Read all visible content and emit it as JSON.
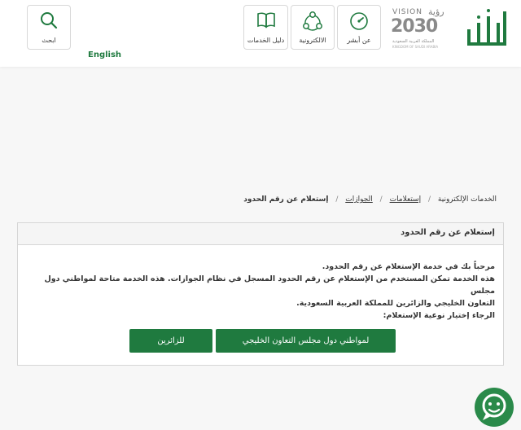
{
  "header": {
    "search_label": "ابحث",
    "english_label": "English",
    "services_guide_label": "دليل الخدمات",
    "electronic_label": "الالكترونية",
    "about_label": "عن أبشر",
    "vision": {
      "line1": "VISION",
      "line1_ar": "رؤية",
      "year": "2030",
      "sub_ar": "المملكة العربية السعودية",
      "sub_en": "KINGDOM OF SAUDI ARABIA"
    },
    "brand_color": "#1f7a3f"
  },
  "breadcrumb": {
    "items": [
      "الخدمات الإلكترونية",
      "إستعلامات",
      "الجوازات"
    ],
    "current": "إستعلام عن رقم الحدود",
    "separator": "/"
  },
  "panel": {
    "title": "إستعلام عن رقم الحدود",
    "lines": [
      "مرحباً بك في خدمة الإستعلام عن رقم الحدود.",
      "هذه الخدمة تمكن المستخدم من الإستعلام عن رقم الحدود المسجل في نظام الجوازات. هذه الخدمة متاحة لمواطني دول مجلس",
      "التعاون الخليجي والزائرين للمملكة العربية السعودية.",
      "الرجاء إختيار نوعية الإستعلام:"
    ],
    "buttons": {
      "gcc": "لمواطني دول مجلس التعاون الخليجي",
      "visitors": "للزائرين"
    }
  },
  "chat": {
    "icon": "chat-bot-icon"
  }
}
